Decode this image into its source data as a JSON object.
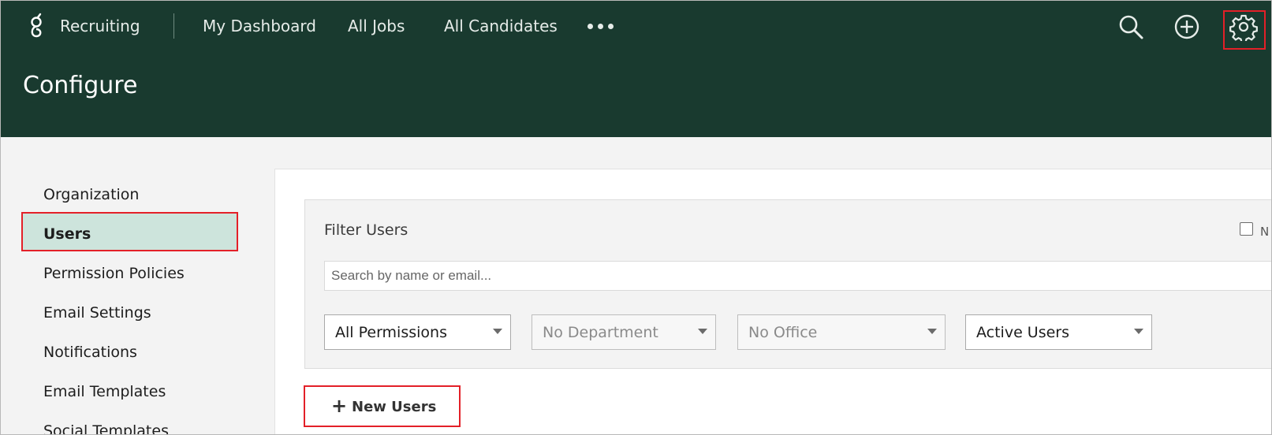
{
  "header": {
    "product_name": "Recruiting",
    "nav": [
      "My Dashboard",
      "All Jobs",
      "All Candidates"
    ],
    "page_title": "Configure",
    "icons": [
      "more-icon",
      "search-icon",
      "add-circle-icon",
      "gear-icon"
    ]
  },
  "sidebar": {
    "items": [
      {
        "label": "Organization"
      },
      {
        "label": "Users",
        "active": true
      },
      {
        "label": "Permission Policies"
      },
      {
        "label": "Email Settings"
      },
      {
        "label": "Notifications"
      },
      {
        "label": "Email Templates"
      },
      {
        "label": "Social Templates"
      }
    ]
  },
  "filters": {
    "title": "Filter Users",
    "checkbox_label": "N",
    "search_placeholder": "Search by name or email...",
    "permissions": "All Permissions",
    "department": "No Department",
    "office": "No Office",
    "status": "Active Users"
  },
  "actions": {
    "new_users_label": "New Users"
  },
  "colors": {
    "header_bg": "#193a2f",
    "active_nav_bg": "#cde4dc",
    "highlight": "#e32028"
  }
}
